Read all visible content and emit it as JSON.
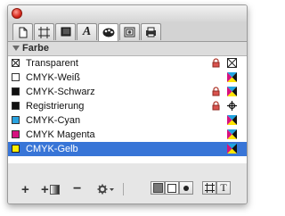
{
  "panel": {
    "title": "",
    "section_title": "Farbe"
  },
  "tabs": [
    {
      "icon": "page-icon"
    },
    {
      "icon": "frame-icon"
    },
    {
      "icon": "box-icon"
    },
    {
      "icon": "character-icon",
      "glyph": "A"
    },
    {
      "icon": "color-palette-icon",
      "active": true
    },
    {
      "icon": "image-icon"
    },
    {
      "icon": "print-icon"
    }
  ],
  "colors": [
    {
      "name": "Transparent",
      "swatch": "none",
      "locked": true,
      "mode": "none"
    },
    {
      "name": "CMYK-Weiß",
      "swatch": "#ffffff",
      "locked": false,
      "mode": "cmyk"
    },
    {
      "name": "CMYK-Schwarz",
      "swatch": "#111111",
      "locked": true,
      "mode": "cmyk"
    },
    {
      "name": "Registrierung",
      "swatch": "#111111",
      "locked": true,
      "mode": "registration"
    },
    {
      "name": "CMYK-Cyan",
      "swatch": "#2aa3e0",
      "locked": false,
      "mode": "cmyk"
    },
    {
      "name": "CMYK Magenta",
      "swatch": "#d6127f",
      "locked": false,
      "mode": "cmyk"
    },
    {
      "name": "CMYK-Gelb",
      "swatch": "#ffee00",
      "locked": false,
      "mode": "cmyk",
      "selected": true
    }
  ],
  "footer": {
    "add_label": "+",
    "add_gradient_label": "+",
    "remove_label": "−",
    "text_mode_label": "T"
  },
  "colors_accent": {
    "selection": "#3875d7"
  }
}
